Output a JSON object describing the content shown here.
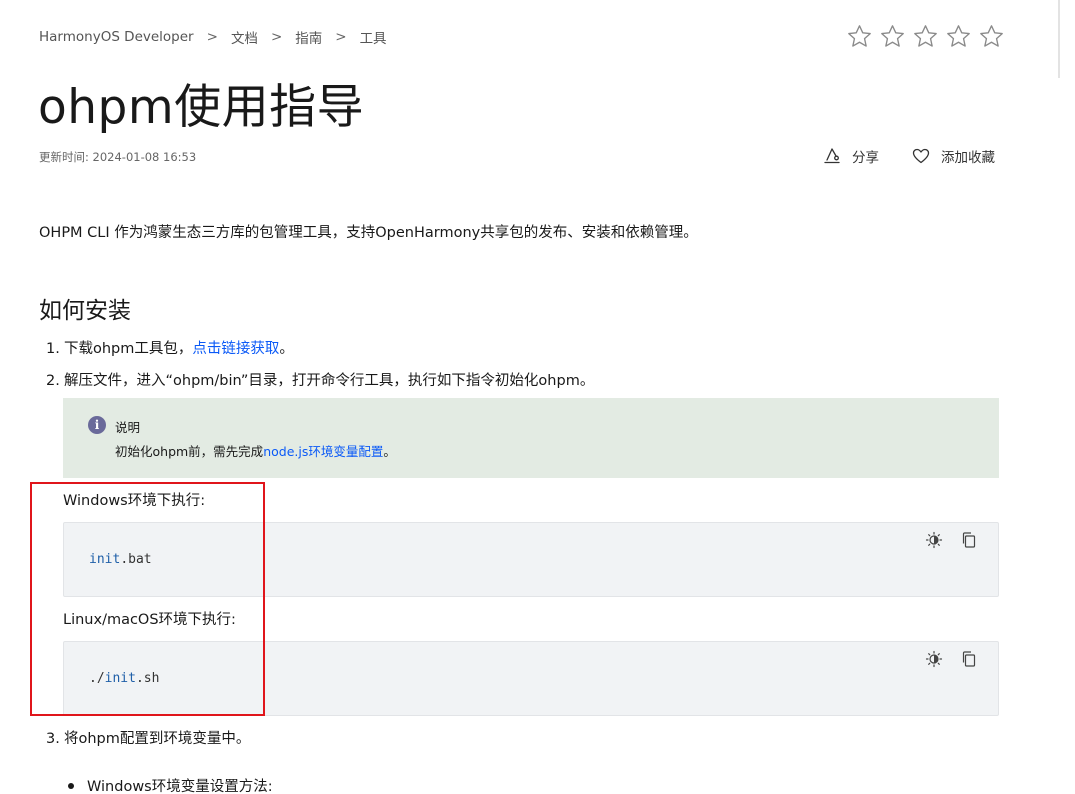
{
  "breadcrumb": {
    "items": [
      "HarmonyOS Developer",
      "文档",
      "指南",
      "工具"
    ],
    "separator": ">"
  },
  "rating": {
    "stars": 5,
    "filled": 0
  },
  "title": "ohpm使用指导",
  "update_time": "更新时间: 2024-01-08 16:53",
  "actions": {
    "share": "分享",
    "favorite": "添加收藏"
  },
  "intro": "OHPM CLI 作为鸿蒙生态三方库的包管理工具，支持OpenHarmony共享包的发布、安装和依赖管理。",
  "section_title": "如何安装",
  "steps": {
    "s1": {
      "num": "1.",
      "text": "下载ohpm工具包，",
      "link": "点击链接获取",
      "suffix": "。"
    },
    "s2": {
      "num": "2.",
      "text": "解压文件，进入“ohpm/bin”目录，打开命令行工具，执行如下指令初始化ohpm。"
    },
    "s3": {
      "num": "3.",
      "text": "将ohpm配置到环境变量中。"
    }
  },
  "note": {
    "icon": "i",
    "label": "说明",
    "text": "初始化ohpm前，需先完成",
    "link": "node.js环境变量配置",
    "suffix": "。"
  },
  "env": {
    "windows_label": "Windows环境下执行:",
    "windows_code": {
      "prefix": "",
      "kw": "init",
      "rest": ".bat"
    },
    "linux_label": "Linux/macOS环境下执行:",
    "linux_code": {
      "prefix": "./",
      "kw": "init",
      "rest": ".sh"
    }
  },
  "bullet": "Windows环境变量设置方法:",
  "colors": {
    "link": "#0a59f7",
    "note_bg": "#e3ebe3",
    "code_bg": "#f1f3f5",
    "highlight": "#e0151b"
  }
}
